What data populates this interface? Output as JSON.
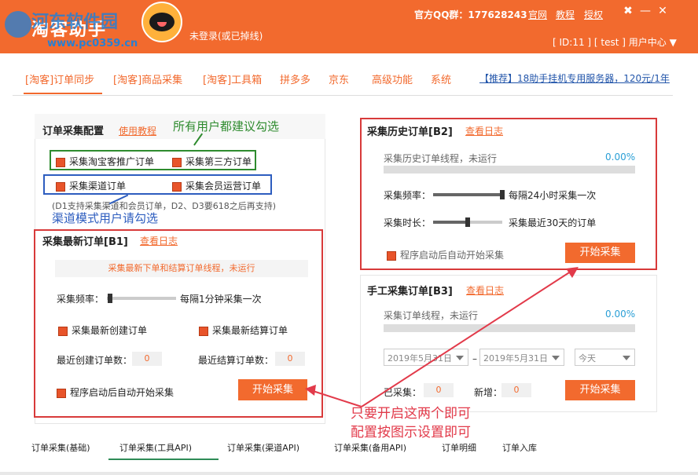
{
  "titlebar": {
    "app_title": "淘客助手",
    "watermark_text": "河东软件园",
    "watermark_url": "www.pc0359.cn",
    "login_status": "未登录(或已掉线)",
    "qq_label": "官方QQ群：177628243",
    "links": [
      "官网",
      "教程",
      "授权"
    ],
    "user_center": "[ ID:11 ] [ test ] 用户中心 ▼"
  },
  "nav": {
    "items": [
      "[淘客]订单同步",
      "[淘客]商品采集",
      "[淘客]工具箱",
      "拼多多",
      "京东",
      "高级功能",
      "系统"
    ],
    "promo": "【推荐】18助手挂机专用服务器，120元/1年"
  },
  "config": {
    "title": "订单采集配置",
    "tutorial_link": "使用教程",
    "options": [
      "采集淘宝客推广订单",
      "采集第三方订单",
      "采集渠道订单",
      "采集会员运营订单"
    ],
    "note": "(D1支持采集渠道和会员订单，D2、D3要618之后再支持)"
  },
  "annotations": {
    "green": "所有用户都建议勾选",
    "blue": "渠道模式用户请勾选",
    "red_line1": "只要开启这两个即可",
    "red_line2": "配置按图示设置即可"
  },
  "b1": {
    "title": "采集最新订单[B1]",
    "log_link": "查看日志",
    "status": "采集最新下单和结算订单线程，未运行",
    "freq_label": "采集频率：",
    "freq_value": "每隔1分钟采集一次",
    "freq_level": 0.05,
    "opt_create": "采集最新创建订单",
    "opt_settle": "采集最新结算订单",
    "count_create_label": "最近创建订单数：",
    "count_create": "0",
    "count_settle_label": "最近结算订单数：",
    "count_settle": "0",
    "autostart": "程序启动后自动开始采集",
    "start_btn": "开始采集"
  },
  "b2": {
    "title": "采集历史订单[B2]",
    "log_link": "查看日志",
    "status": "采集历史订单线程，未运行",
    "percent": "0.00%",
    "freq_label": "采集频率：",
    "freq_value": "每隔24小时采集一次",
    "freq_level": 1.0,
    "dur_label": "采集时长：",
    "dur_value": "采集最近30天的订单",
    "dur_level": 0.5,
    "autostart": "程序启动后自动开始采集",
    "start_btn": "开始采集"
  },
  "b3": {
    "title": "手工采集订单[B3]",
    "log_link": "查看日志",
    "status": "采集订单线程，未运行",
    "percent": "0.00%",
    "date_from": "2019年5月31日",
    "date_to": "2019年5月31日",
    "range": "今天",
    "collected_label": "已采集：",
    "collected": "0",
    "new_label": "新增：",
    "new_count": "0",
    "start_btn": "开始采集"
  },
  "bottom_tabs": [
    "订单采集(基础)",
    "订单采集(工具API)",
    "订单采集(渠道API)",
    "订单采集(备用API)",
    "订单明细",
    "订单入库"
  ],
  "colors": {
    "accent": "#f26a2e",
    "annotation_red": "#d83a3a",
    "annotation_green": "#2e8b2e",
    "annotation_blue": "#2d5dbf"
  }
}
